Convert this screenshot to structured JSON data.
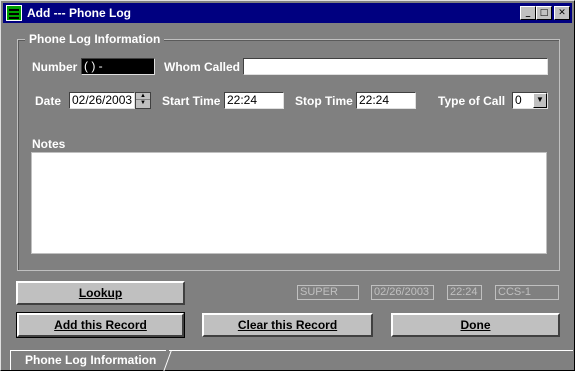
{
  "window": {
    "title": "Add --- Phone Log"
  },
  "group": {
    "legend": "Phone Log Information"
  },
  "fields": {
    "number_label": "Number",
    "number_value": "(   )    -",
    "whom_called_label": "Whom Called",
    "whom_called_value": "",
    "date_label": "Date",
    "date_value": "02/26/2003",
    "start_time_label": "Start Time",
    "start_time_value": "22:24",
    "stop_time_label": "Stop Time",
    "stop_time_value": "22:24",
    "type_of_call_label": "Type of Call",
    "type_of_call_value": "0",
    "notes_label": "Notes",
    "notes_value": ""
  },
  "buttons": {
    "lookup_label": "Lookup",
    "add_label": "Add this Record",
    "clear_label": "Clear this Record",
    "done_label": "Done"
  },
  "status": {
    "user": "SUPER",
    "date": "02/26/2003",
    "time": "22:24",
    "code": "CCS-1"
  },
  "tabs": [
    {
      "label": "Phone Log Information"
    }
  ],
  "icons": {
    "app": "phone-log-app-icon",
    "minimize": "minimize-icon",
    "maximize": "maximize-icon",
    "close": "close-icon",
    "spin": "spin-arrows-icon",
    "dropdown": "chevron-down-icon"
  },
  "colors": {
    "titlebar": "#000080",
    "window_bg": "#808080",
    "button_face": "#c0c0c0"
  }
}
